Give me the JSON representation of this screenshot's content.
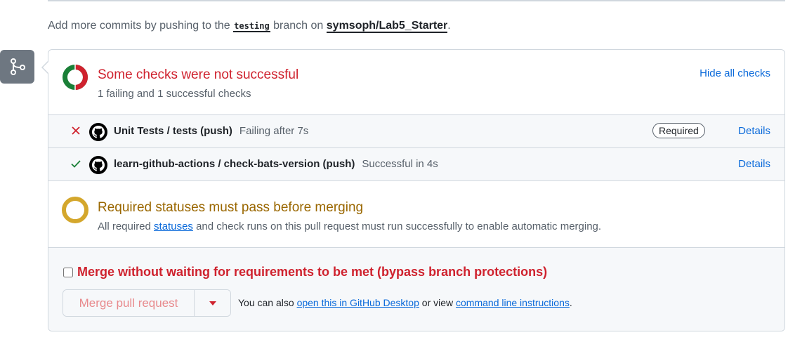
{
  "intro": {
    "prefix": "Add more commits by pushing to the ",
    "branch": "testing",
    "middle": " branch on ",
    "repo": "symsoph/Lab5_Starter",
    "suffix": "."
  },
  "checks_summary": {
    "title": "Some checks were not successful",
    "subtitle": "1 failing and 1 successful checks",
    "hide_link": "Hide all checks"
  },
  "checks": [
    {
      "name": "Unit Tests / tests (push)",
      "status": "Failing after 7s",
      "state": "failure",
      "badge": "Required",
      "details": "Details"
    },
    {
      "name": "learn-github-actions / check-bats-version (push)",
      "status": "Successful in 4s",
      "state": "success",
      "details": "Details"
    }
  ],
  "required_statuses": {
    "title": "Required statuses must pass before merging",
    "sub_prefix": "All required ",
    "sub_link": "statuses",
    "sub_suffix": " and check runs on this pull request must run successfully to enable automatic merging."
  },
  "merge": {
    "bypass_label": "Merge without waiting for requirements to be met (bypass branch protections)",
    "button_label": "Merge pull request",
    "note_prefix": "You can also ",
    "desktop_link": "open this in GitHub Desktop",
    "note_middle": " or view ",
    "cli_link": "command line instructions",
    "note_suffix": "."
  },
  "colors": {
    "danger": "#cf222e",
    "success": "#1a7f37",
    "attention": "#d4a72c",
    "link": "#0969da"
  },
  "icons": {
    "merge": "git-merge-icon",
    "fail": "x-icon",
    "pass": "check-icon",
    "app": "github-logo-icon"
  }
}
